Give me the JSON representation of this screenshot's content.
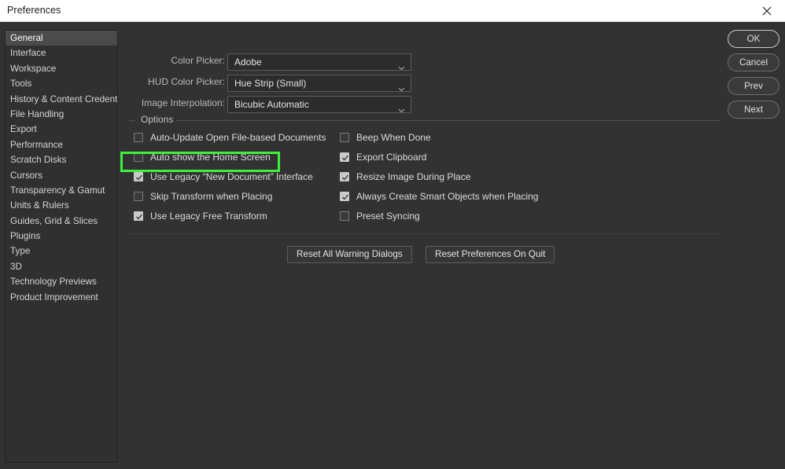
{
  "window": {
    "title": "Preferences",
    "close_icon": "close-icon"
  },
  "sidebar": {
    "items": [
      {
        "label": "General",
        "selected": true
      },
      {
        "label": "Interface",
        "selected": false
      },
      {
        "label": "Workspace",
        "selected": false
      },
      {
        "label": "Tools",
        "selected": false
      },
      {
        "label": "History & Content Credentials",
        "selected": false
      },
      {
        "label": "File Handling",
        "selected": false
      },
      {
        "label": "Export",
        "selected": false
      },
      {
        "label": "Performance",
        "selected": false
      },
      {
        "label": "Scratch Disks",
        "selected": false
      },
      {
        "label": "Cursors",
        "selected": false
      },
      {
        "label": "Transparency & Gamut",
        "selected": false
      },
      {
        "label": "Units & Rulers",
        "selected": false
      },
      {
        "label": "Guides, Grid & Slices",
        "selected": false
      },
      {
        "label": "Plugins",
        "selected": false
      },
      {
        "label": "Type",
        "selected": false
      },
      {
        "label": "3D",
        "selected": false
      },
      {
        "label": "Technology Previews",
        "selected": false
      },
      {
        "label": "Product Improvement",
        "selected": false
      }
    ]
  },
  "action_buttons": [
    {
      "label": "OK",
      "primary": true
    },
    {
      "label": "Cancel",
      "primary": false
    },
    {
      "label": "Prev",
      "primary": false
    },
    {
      "label": "Next",
      "primary": false
    }
  ],
  "settings": {
    "dropdowns": [
      {
        "label": "Color Picker:",
        "value": "Adobe",
        "chevron": "chevron-down-icon"
      },
      {
        "label": "HUD Color Picker:",
        "value": "Hue Strip (Small)",
        "chevron": "chevron-down-icon"
      },
      {
        "label": "Image Interpolation:",
        "value": "Bicubic Automatic",
        "chevron": "chevron-down-icon"
      }
    ]
  },
  "options_group": {
    "title": "Options",
    "left_column": [
      {
        "label": "Auto-Update Open File-based Documents",
        "checked": false
      },
      {
        "label": "Auto show the Home Screen",
        "checked": false,
        "highlighted": true
      },
      {
        "label": "Use Legacy “New Document” Interface",
        "checked": true
      },
      {
        "label": "Skip Transform when Placing",
        "checked": false
      },
      {
        "label": "Use Legacy Free Transform",
        "checked": true
      }
    ],
    "right_column": [
      {
        "label": "Beep When Done",
        "checked": false
      },
      {
        "label": "Export Clipboard",
        "checked": true
      },
      {
        "label": "Resize Image During Place",
        "checked": true
      },
      {
        "label": "Always Create Smart Objects when Placing",
        "checked": true
      },
      {
        "label": "Preset Syncing",
        "checked": false
      }
    ]
  },
  "reset_buttons": [
    {
      "label": "Reset All Warning Dialogs"
    },
    {
      "label": "Reset Preferences On Quit"
    }
  ],
  "colors": {
    "highlight": "#3cf03c",
    "dialog_bg": "#323232",
    "titlebar_bg": "#ffffff",
    "selected_row": "#4b4b4b"
  }
}
